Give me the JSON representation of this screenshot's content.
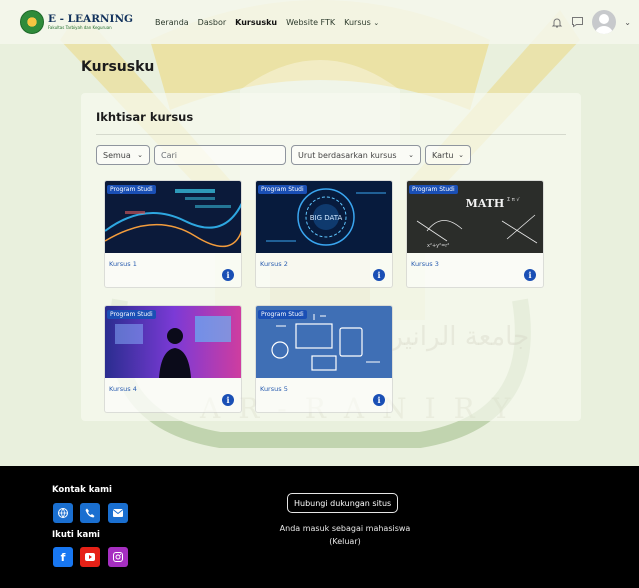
{
  "brand": {
    "title": "E - LEARNING",
    "subtitle": "Fakultas Tarbiyah dan Keguruan"
  },
  "nav": {
    "items": [
      {
        "label": "Beranda",
        "active": false
      },
      {
        "label": "Dasbor",
        "active": false
      },
      {
        "label": "Kursusku",
        "active": true
      },
      {
        "label": "Website FTK",
        "active": false
      },
      {
        "label": "Kursus",
        "active": false,
        "dropdown": true
      }
    ],
    "icons": [
      "bell-icon",
      "chat-icon",
      "user-avatar-icon",
      "chevron-down-icon"
    ]
  },
  "page": {
    "title": "Kursusku"
  },
  "overview": {
    "title": "Ikhtisar kursus",
    "filter_label": "Semua",
    "search_placeholder": "Cari",
    "sort_label": "Urut berdasarkan kursus",
    "view_label": "Kartu"
  },
  "courses": [
    {
      "name": "Kursus 1",
      "category": "Program Studi"
    },
    {
      "name": "Kursus 2",
      "category": "Program Studi"
    },
    {
      "name": "Kursus 3",
      "category": "Program Studi"
    },
    {
      "name": "Kursus 4",
      "category": "Program Studi"
    },
    {
      "name": "Kursus 5",
      "category": "Program Studi"
    }
  ],
  "footer": {
    "contact_heading": "Kontak kami",
    "follow_heading": "Ikuti kami",
    "support_button": "Hubungi dukungan situs",
    "login_text": "Anda masuk sebagai mahasiswa",
    "logout_link": "(Keluar)"
  },
  "colors": {
    "primary": "#1a4fb5",
    "page_bg": "#e9f0dd",
    "footer_bg": "#000000",
    "facebook": "#1877f2",
    "youtube": "#e62117",
    "instagram": "#a62fc1"
  }
}
